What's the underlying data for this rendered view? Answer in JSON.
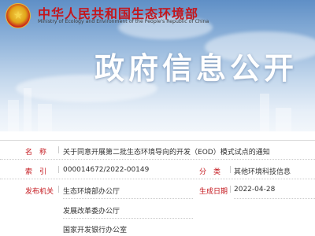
{
  "header": {
    "site_title": "中华人民共和国生态环境部",
    "site_subtitle": "Ministry of Ecology and Environment of the People's Republic of China",
    "section_title": "政府信息公开",
    "emblem_char": "★"
  },
  "info": {
    "name_label": "名　称",
    "name_value": "关于同意开展第二批生态环境导向的开发（EOD）模式试点的通知",
    "index_label": "索　引",
    "index_value": "000014672/2022-00149",
    "category_label": "分　类",
    "category_value": "其他环境科技信息",
    "issuer_label": "发布机关",
    "issuers": [
      "生态环境部办公厅",
      "发展改革委办公厅",
      "国家开发银行办公室"
    ],
    "date_label": "生成日期",
    "date_value": "2022-04-28",
    "separator": "|"
  }
}
